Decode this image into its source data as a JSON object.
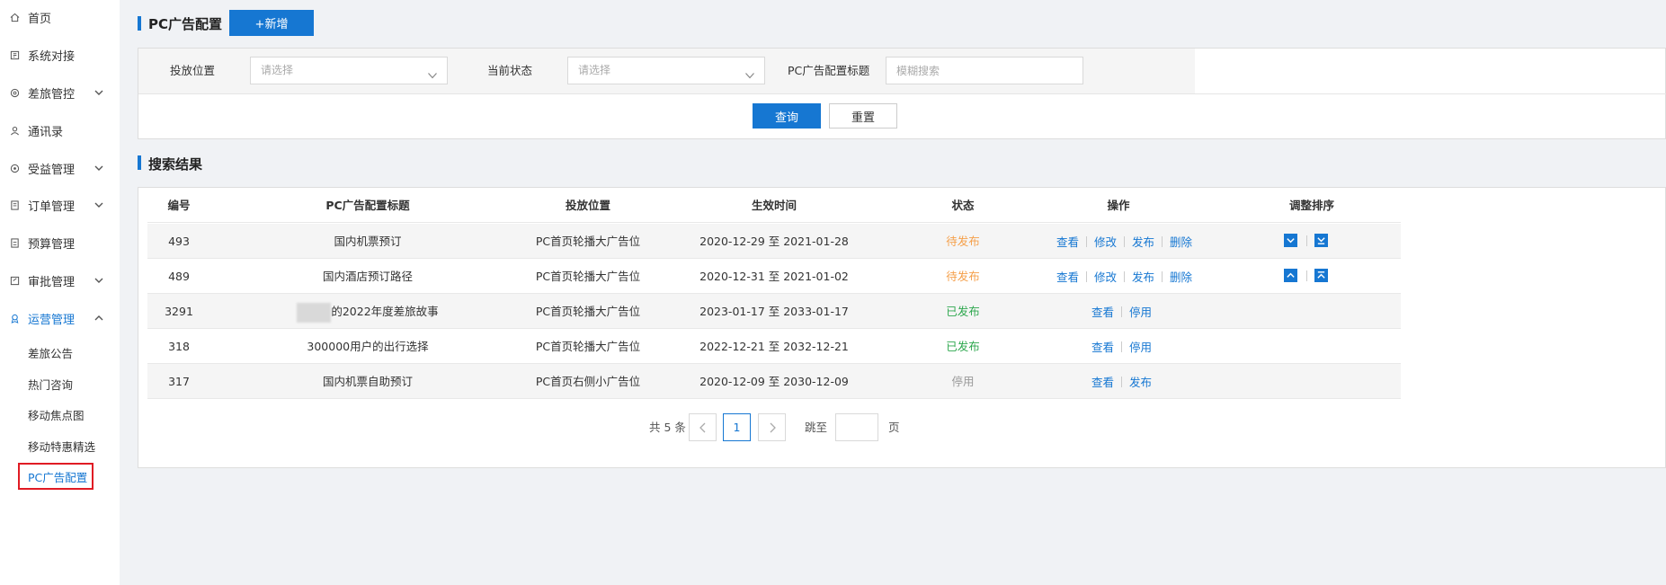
{
  "sidebar": {
    "items": [
      {
        "label": "首页",
        "icon": "home-icon"
      },
      {
        "label": "系统对接",
        "icon": "link-icon"
      },
      {
        "label": "差旅管控",
        "icon": "settings-icon",
        "expand": "chevron-down"
      },
      {
        "label": "通讯录",
        "icon": "contacts-icon"
      },
      {
        "label": "受益管理",
        "icon": "target-icon",
        "expand": "chevron-down"
      },
      {
        "label": "订单管理",
        "icon": "order-icon",
        "expand": "chevron-down"
      },
      {
        "label": "预算管理",
        "icon": "budget-icon"
      },
      {
        "label": "审批管理",
        "icon": "approval-icon",
        "expand": "chevron-down"
      },
      {
        "label": "运营管理",
        "icon": "operation-icon",
        "expand": "chevron-up",
        "active": true
      }
    ],
    "subitems": [
      {
        "label": "差旅公告"
      },
      {
        "label": "热门咨询"
      },
      {
        "label": "移动焦点图"
      },
      {
        "label": "移动特惠精选"
      },
      {
        "label": "PC广告配置",
        "current": true
      }
    ]
  },
  "header": {
    "title": "PC广告配置",
    "add_label": "+新增"
  },
  "filters": {
    "position_label": "投放位置",
    "position_placeholder": "请选择",
    "status_label": "当前状态",
    "status_placeholder": "请选择",
    "title_label": "PC广告配置标题",
    "title_placeholder": "模糊搜索",
    "query_label": "查询",
    "reset_label": "重置"
  },
  "results": {
    "title": "搜索结果",
    "columns": [
      "编号",
      "PC广告配置标题",
      "投放位置",
      "生效时间",
      "状态",
      "操作",
      "调整排序"
    ],
    "rows": [
      {
        "id": "493",
        "title": "国内机票预订",
        "position": "PC首页轮播大广告位",
        "period": "2020-12-29 至 2021-01-28",
        "status": "待发布",
        "status_type": "pending",
        "ops": [
          "查看",
          "修改",
          "发布",
          "删除"
        ],
        "sort": [
          "move-down",
          "move-bottom"
        ]
      },
      {
        "id": "489",
        "title": "国内酒店预订路径",
        "position": "PC首页轮播大广告位",
        "period": "2020-12-31 至 2021-01-02",
        "status": "待发布",
        "status_type": "pending",
        "ops": [
          "查看",
          "修改",
          "发布",
          "删除"
        ],
        "sort": [
          "move-up",
          "move-top"
        ]
      },
      {
        "id": "3291",
        "title": "的2022年度差旅故事",
        "position": "PC首页轮播大广告位",
        "period": "2023-01-17 至 2033-01-17",
        "status": "已发布",
        "status_type": "published",
        "ops": [
          "查看",
          "停用"
        ],
        "sort": []
      },
      {
        "id": "318",
        "title": "300000用户的出行选择",
        "position": "PC首页轮播大广告位",
        "period": "2022-12-21 至 2032-12-21",
        "status": "已发布",
        "status_type": "published",
        "ops": [
          "查看",
          "停用"
        ],
        "sort": []
      },
      {
        "id": "317",
        "title": "国内机票自助预订",
        "position": "PC首页右侧小广告位",
        "period": "2020-12-09 至 2030-12-09",
        "status": "停用",
        "status_type": "stopped",
        "ops": [
          "查看",
          "发布"
        ],
        "sort": []
      }
    ]
  },
  "pagination": {
    "total": "共 5 条",
    "current_page": "1",
    "jump_label": "跳至",
    "page_suffix": "页"
  },
  "colors": {
    "primary": "#1677d2",
    "pending": "#f5a04b",
    "published": "#2fa84f",
    "stopped": "#999999",
    "highlight_box": "#e01b24"
  }
}
